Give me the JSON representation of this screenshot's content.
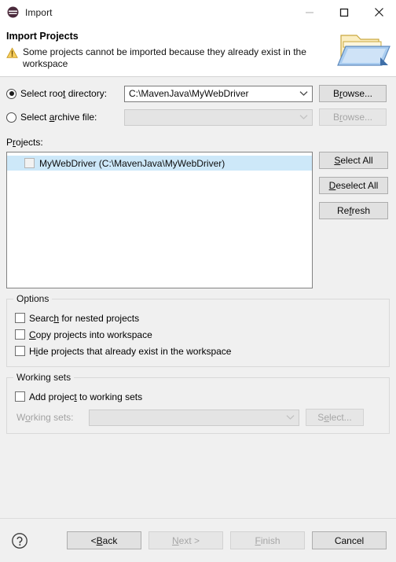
{
  "window": {
    "title": "Import",
    "icon": "eclipse-icon",
    "controls": {
      "minimize": "minimize-icon",
      "maximize": "maximize-icon",
      "close": "close-icon"
    }
  },
  "header": {
    "title": "Import Projects",
    "status_icon": "warning-icon",
    "message": "Some projects cannot be imported because they already exist in the workspace",
    "banner_icon": "open-folder-icon"
  },
  "source": {
    "root_directory": {
      "label_pre": "Select roo",
      "label_mnemonic": "t",
      "label_post": " directory:",
      "selected": true,
      "value": "C:\\MavenJava\\MyWebDriver",
      "browse_pre": "B",
      "browse_mnemonic": "r",
      "browse_post": "owse...",
      "enabled": true
    },
    "archive_file": {
      "label_pre": "Select ",
      "label_mnemonic": "a",
      "label_post": "rchive file:",
      "selected": false,
      "value": "",
      "browse_pre": "B",
      "browse_mnemonic": "r",
      "browse_post": "owse...",
      "enabled": false
    }
  },
  "projects": {
    "label_pre": "P",
    "label_mnemonic": "r",
    "label_post": "ojects:",
    "items": [
      {
        "label": "MyWebDriver (C:\\MavenJava\\MyWebDriver)",
        "checked": false,
        "selected": true,
        "enabled": false
      }
    ],
    "buttons": [
      {
        "pre": "",
        "mnemonic": "S",
        "post": "elect All",
        "enabled": true
      },
      {
        "pre": "",
        "mnemonic": "D",
        "post": "eselect All",
        "enabled": true
      },
      {
        "pre": "Re",
        "mnemonic": "f",
        "post": "resh",
        "enabled": true
      }
    ]
  },
  "options": {
    "title": "Options",
    "checkboxes": [
      {
        "pre": "Searc",
        "mnemonic": "h",
        "post": " for nested projects",
        "checked": false
      },
      {
        "pre": "",
        "mnemonic": "C",
        "post": "opy projects into workspace",
        "checked": false
      },
      {
        "pre": "H",
        "mnemonic": "i",
        "post": "de projects that already exist in the workspace",
        "checked": false
      }
    ]
  },
  "working_sets": {
    "title": "Working sets",
    "add_checkbox": {
      "pre": "Add projec",
      "mnemonic": "t",
      "post": " to working sets",
      "checked": false
    },
    "label_pre": "W",
    "label_mnemonic": "o",
    "label_post": "rking sets:",
    "value": "",
    "select_pre": "S",
    "select_mnemonic": "e",
    "select_post": "lect...",
    "enabled": false
  },
  "footer": {
    "help_icon": "help-icon",
    "buttons": [
      {
        "pre": "< ",
        "mnemonic": "B",
        "post": "ack",
        "enabled": true
      },
      {
        "pre": "",
        "mnemonic": "N",
        "post": "ext >",
        "enabled": false
      },
      {
        "pre": "",
        "mnemonic": "F",
        "post": "inish",
        "enabled": false
      },
      {
        "pre": "",
        "mnemonic": "",
        "post": "Cancel",
        "enabled": true
      }
    ]
  },
  "colors": {
    "body_bg": "#f0f0f0",
    "header_bg": "#ffffff",
    "selection": "#cde8f9",
    "warning": "#f5c042",
    "folder_blue": "#7fb3e8"
  }
}
